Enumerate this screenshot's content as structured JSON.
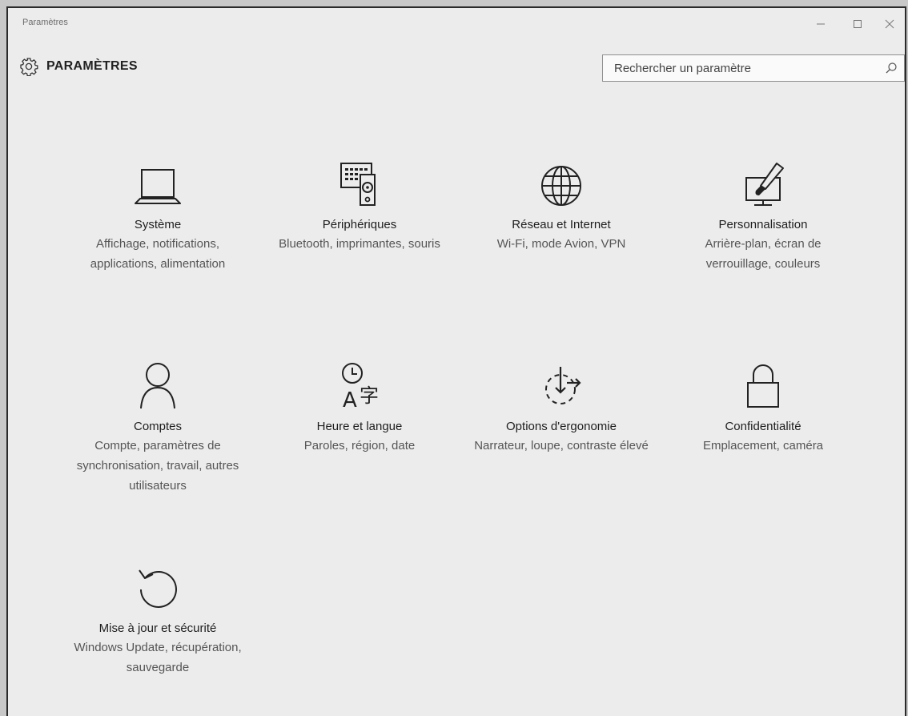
{
  "window": {
    "title": "Paramètres"
  },
  "header": {
    "title": "PARAMÈTRES"
  },
  "search": {
    "placeholder": "Rechercher un paramètre"
  },
  "categories": [
    {
      "name": "Système",
      "description": "Affichage, notifications, applications, alimentation",
      "icon": "laptop-icon"
    },
    {
      "name": "Périphériques",
      "description": "Bluetooth, imprimantes, souris",
      "icon": "devices-icon"
    },
    {
      "name": "Réseau et Internet",
      "description": "Wi-Fi, mode Avion, VPN",
      "icon": "globe-icon"
    },
    {
      "name": "Personnalisation",
      "description": "Arrière-plan, écran de verrouillage, couleurs",
      "icon": "paintbrush-monitor-icon"
    },
    {
      "name": "Comptes",
      "description": "Compte, paramètres de synchronisation, travail, autres utilisateurs",
      "icon": "person-icon"
    },
    {
      "name": "Heure et langue",
      "description": "Paroles, région, date",
      "icon": "time-language-icon"
    },
    {
      "name": "Options d'ergonomie",
      "description": "Narrateur, loupe, contraste élevé",
      "icon": "ease-of-access-icon"
    },
    {
      "name": "Confidentialité",
      "description": "Emplacement, caméra",
      "icon": "lock-icon"
    },
    {
      "name": "Mise à jour et sécurité",
      "description": "Windows Update, récupération, sauvegarde",
      "icon": "update-icon"
    }
  ]
}
